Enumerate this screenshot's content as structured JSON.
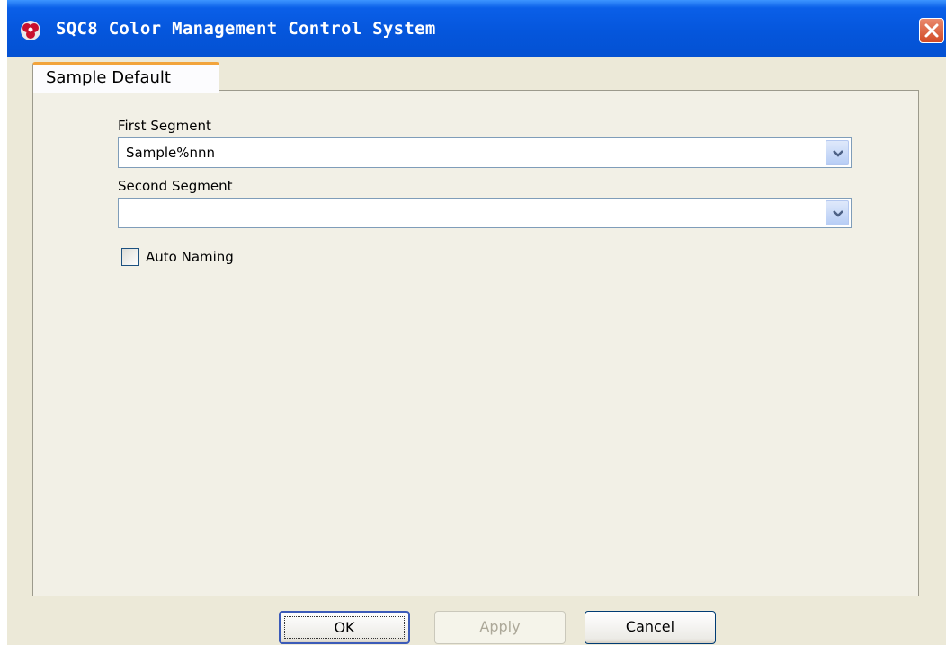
{
  "window": {
    "title": "SQC8 Color Management Control System"
  },
  "tabs": [
    {
      "label": "Sample Default",
      "active": true
    }
  ],
  "form": {
    "first_segment_label": "First Segment",
    "first_segment_value": "Sample%nnn",
    "second_segment_label": "Second Segment",
    "second_segment_value": "",
    "auto_naming_label": "Auto Naming",
    "auto_naming_checked": false
  },
  "buttons": {
    "ok": "OK",
    "apply": "Apply",
    "cancel": "Cancel"
  },
  "colors": {
    "titlebar": "#0556dc",
    "window_bg": "#ece9d8",
    "tab_accent": "#f2a43c",
    "close_button": "#d24a26"
  },
  "icons": {
    "app": "app-logo-icon",
    "close": "close-icon",
    "dropdown": "chevron-down-icon"
  }
}
